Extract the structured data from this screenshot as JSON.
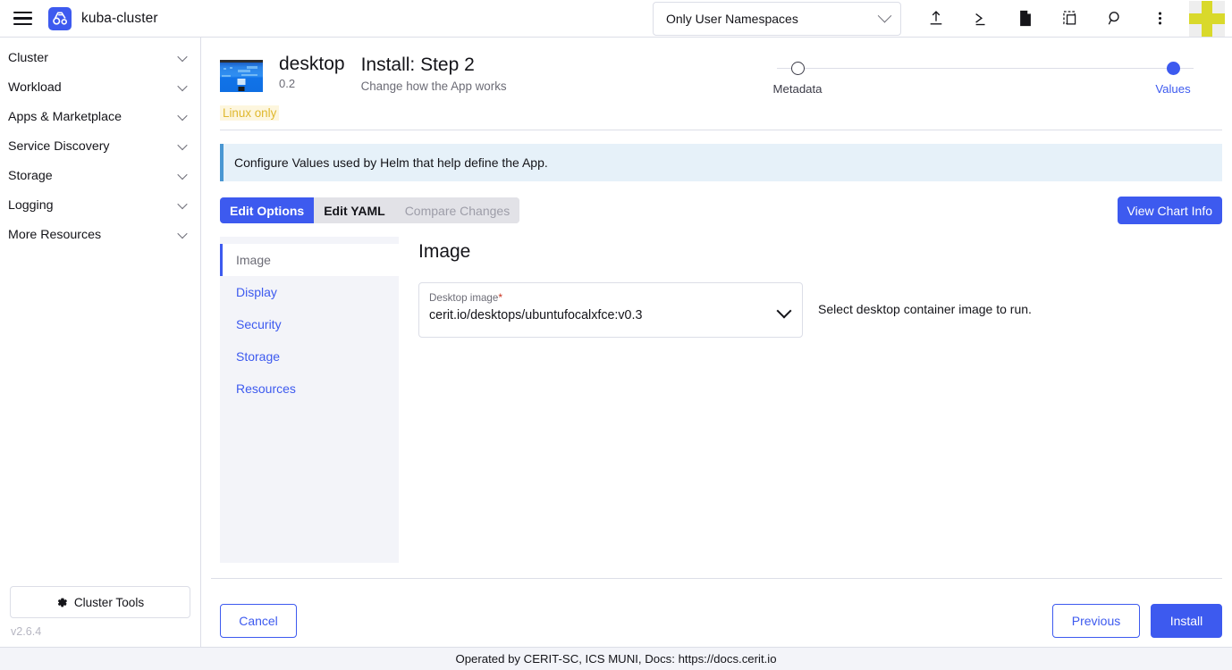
{
  "topbar": {
    "menu_icon": "hamburger-icon",
    "cluster_logo_icon": "cluster-logo-icon",
    "cluster_name": "kuba-cluster",
    "namespace_filter": {
      "value": "Only User Namespaces",
      "chevron_icon": "chevron-down-icon"
    },
    "icons": [
      {
        "name": "import-yaml-icon",
        "glyph": "upload"
      },
      {
        "name": "kubectl-shell-icon",
        "glyph": "terminal"
      },
      {
        "name": "download-kubeconfig-icon",
        "glyph": "file"
      },
      {
        "name": "copy-kubeconfig-icon",
        "glyph": "copy"
      },
      {
        "name": "search-icon",
        "glyph": "magnifier"
      },
      {
        "name": "more-options-icon",
        "glyph": "kebab"
      }
    ],
    "user_logo": "cerit-sc-logo-icon"
  },
  "sidebar": {
    "items": [
      {
        "label": "Cluster"
      },
      {
        "label": "Workload"
      },
      {
        "label": "Apps & Marketplace"
      },
      {
        "label": "Service Discovery"
      },
      {
        "label": "Storage"
      },
      {
        "label": "Logging"
      },
      {
        "label": "More Resources"
      }
    ],
    "cluster_tools": {
      "label": "Cluster Tools",
      "icon": "gear-icon"
    },
    "version": "v2.6.4"
  },
  "header": {
    "app_icon": "desktop-app-thumbnail",
    "app_name": "desktop",
    "app_version": "0.2",
    "install_title": "Install: Step 2",
    "install_subtitle": "Change how the App works",
    "linux_only_badge": "Linux only",
    "steps": [
      {
        "label": "Metadata",
        "active": false,
        "state_icon": "step-circle-empty"
      },
      {
        "label": "Values",
        "active": true,
        "state_icon": "step-circle-filled"
      }
    ]
  },
  "banner": {
    "text": "Configure Values used by Helm that help define the App.",
    "accent_color": "#4a97d2",
    "bg_color": "#e6f1f9"
  },
  "tabs": {
    "items": [
      {
        "label": "Edit Options",
        "selected": true,
        "disabled": false
      },
      {
        "label": "Edit YAML",
        "selected": false,
        "disabled": false
      },
      {
        "label": "Compare Changes",
        "selected": false,
        "disabled": true
      }
    ],
    "view_chart_info": "View Chart Info"
  },
  "side_tabs": [
    {
      "label": "Image",
      "active": true
    },
    {
      "label": "Display",
      "active": false
    },
    {
      "label": "Security",
      "active": false
    },
    {
      "label": "Storage",
      "active": false
    },
    {
      "label": "Resources",
      "active": false
    }
  ],
  "pane": {
    "title": "Image",
    "field": {
      "label": "Desktop image",
      "required_marker": "*",
      "value": "cerit.io/desktops/ubuntufocalxfce:v0.3",
      "chevron_icon": "chevron-down-icon"
    },
    "help_text": "Select desktop container image to run."
  },
  "footer_actions": {
    "cancel": "Cancel",
    "previous": "Previous",
    "install": "Install"
  },
  "footer": {
    "text": "Operated by CERIT-SC, ICS MUNI, Docs: https://docs.cerit.io"
  },
  "colors": {
    "accent": "#3d5aef",
    "link": "#3d5aef",
    "warning": "#dfb82e",
    "panel_bg": "#f3f4f9",
    "border": "#dcdee7"
  }
}
